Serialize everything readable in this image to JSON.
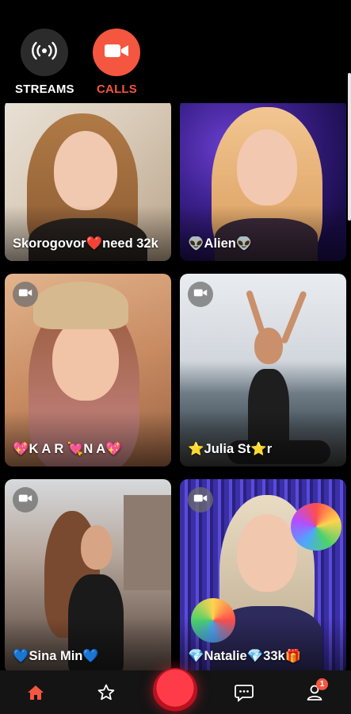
{
  "header": {
    "streams_label": "STREAMS",
    "calls_label": "CALLS",
    "active_tab": "CALLS",
    "accent_color": "#f4563f"
  },
  "cards": [
    {
      "name": "Skorogovor❤️need 32k",
      "has_video_badge": false
    },
    {
      "name": "👽Alien👽",
      "has_video_badge": false
    },
    {
      "name": "💖K A R 💘N A💖",
      "has_video_badge": true
    },
    {
      "name": "⭐Julia St⭐r",
      "has_video_badge": true
    },
    {
      "name": "💙Sina Min💙",
      "has_video_badge": true
    },
    {
      "name": "💎Natalie💎33k🎁",
      "has_video_badge": true
    }
  ],
  "nav": {
    "items": [
      "home-icon",
      "favorites-icon",
      "record-button",
      "messages-icon",
      "profile-icon"
    ],
    "active": "home-icon",
    "notification_count": "1"
  }
}
